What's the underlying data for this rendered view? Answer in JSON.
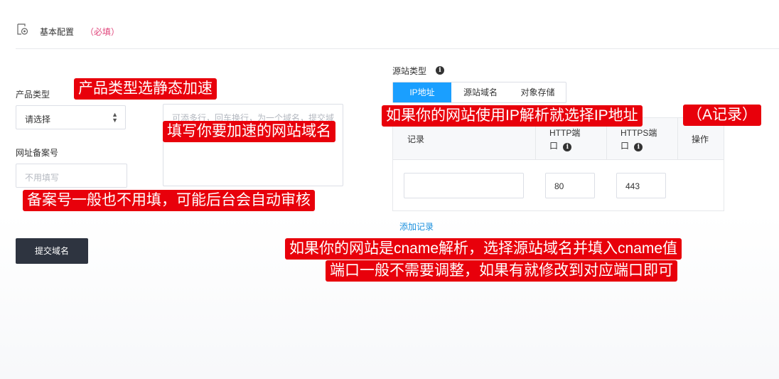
{
  "header": {
    "title": "基本配置",
    "required_note": "（必填）"
  },
  "left_form": {
    "product_type_label": "产品类型",
    "product_type_value": "请选择",
    "icp_label": "网址备案号",
    "icp_placeholder": "不用填写",
    "domains_placeholder": "可添多行，回车换行，为一个域名，提交域",
    "submit_label": "提交域名"
  },
  "origin": {
    "type_label": "源站类型",
    "tabs": [
      {
        "label": "IP地址",
        "active": true
      },
      {
        "label": "源站域名",
        "active": false
      },
      {
        "label": "对象存储",
        "active": false
      }
    ],
    "table": {
      "headers": {
        "record": "记录",
        "http_port": "HTTP端口",
        "https_port": "HTTPS端口",
        "action": "操作"
      },
      "row": {
        "record_value": "",
        "http_port_value": "80",
        "https_port_value": "443"
      }
    },
    "add_record_label": "添加记录"
  },
  "annotations": {
    "product_type": "产品类型选静态加速",
    "domain": "填写你要加速的网站域名",
    "icp": "备案号一般也不用填，可能后台会自动审核",
    "ip": "如果你的网站使用IP解析就选择IP地址",
    "a_record": "（A记录）",
    "cname": "如果你的网站是cname解析，选择源站域名并填入cname值",
    "port": "端口一般不需要调整，如果有就修改到对应端口即可"
  },
  "colors": {
    "accent": "#1a9fff",
    "annotation_bg": "#e8000b",
    "submit_bg": "#2e3440",
    "required": "#e0457b"
  }
}
